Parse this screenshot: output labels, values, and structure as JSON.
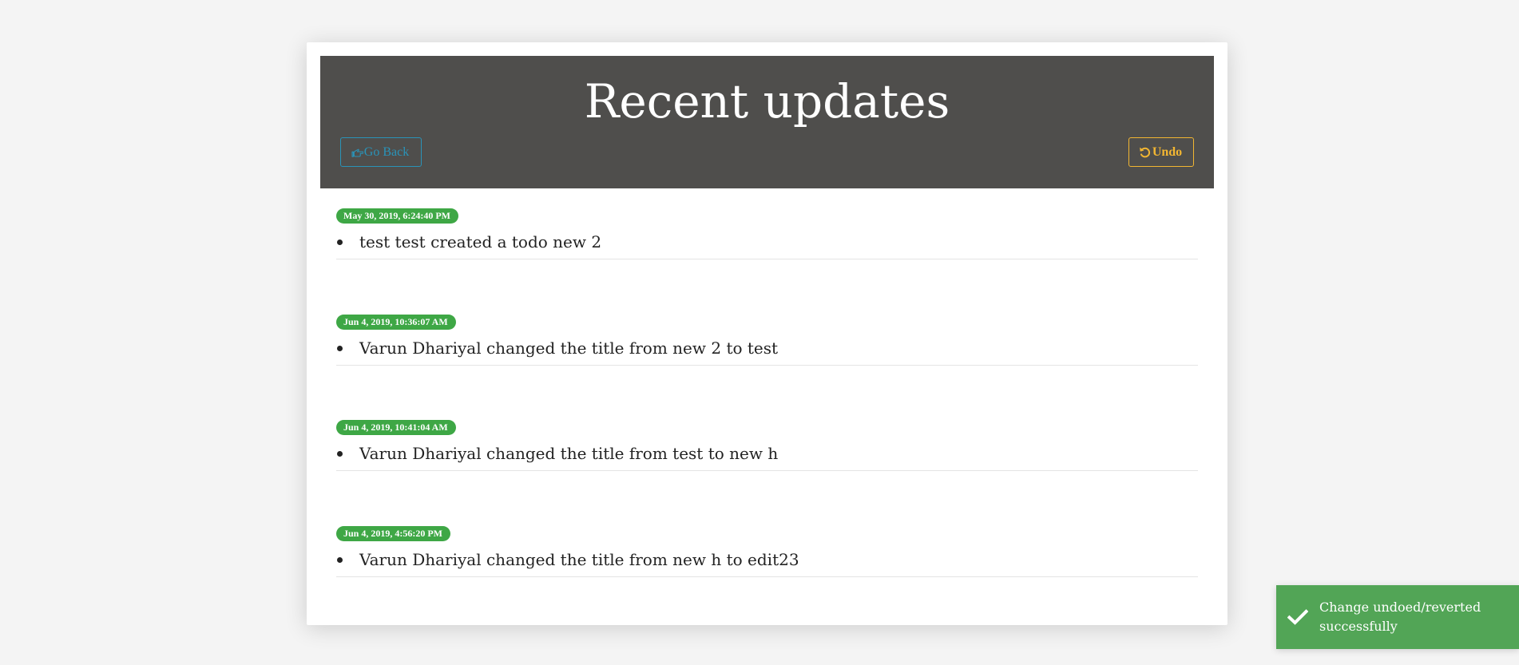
{
  "header": {
    "title": "Recent updates",
    "back_label": "Go Back",
    "undo_label": "Undo",
    "back_icon": "hand-pointing-left-icon",
    "undo_icon": "undo-icon"
  },
  "updates": [
    {
      "timestamp": "May 30, 2019, 6:24:40 PM",
      "text": "test test created a todo new 2"
    },
    {
      "timestamp": "Jun 4, 2019, 10:36:07 AM",
      "text": "Varun Dhariyal changed the title from new 2 to test"
    },
    {
      "timestamp": "Jun 4, 2019, 10:41:04 AM",
      "text": "Varun Dhariyal changed the title from test to new h"
    },
    {
      "timestamp": "Jun 4, 2019, 4:56:20 PM",
      "text": "Varun Dhariyal changed the title from new h to edit23"
    }
  ],
  "toast": {
    "message": "Change undoed/reverted successfully",
    "icon": "check-icon"
  },
  "colors": {
    "page_bg": "#f4f4f4",
    "header_bg": "#4f4e4c",
    "back_accent": "#2a93b8",
    "undo_accent": "#f2b632",
    "badge_bg": "#3ea745",
    "toast_bg": "#52a556"
  }
}
